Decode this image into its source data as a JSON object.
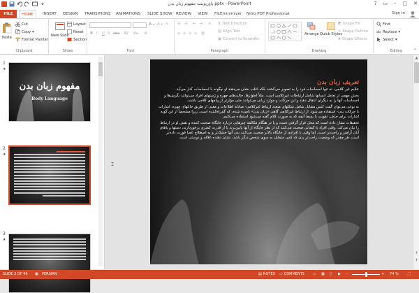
{
  "window": {
    "title": "پاورپوینت مفهوم زبان بدن.pptx - PowerPoint",
    "signin": "Sign in"
  },
  "tabs": [
    {
      "label": "FILE"
    },
    {
      "label": "HOME"
    },
    {
      "label": "INSERT"
    },
    {
      "label": "DESIGN"
    },
    {
      "label": "TRANSITIONS"
    },
    {
      "label": "ANIMATIONS"
    },
    {
      "label": "SLIDE SHOW"
    },
    {
      "label": "REVIEW"
    },
    {
      "label": "VIEW"
    },
    {
      "label": "FILEminimizer"
    },
    {
      "label": "Nitro PDF Professional"
    }
  ],
  "ribbon": {
    "clipboard": {
      "paste": "Paste",
      "cut": "Cut",
      "copy": "Copy",
      "format_painter": "Format Painter",
      "label": "Clipboard"
    },
    "slides": {
      "new_slide": "New Slide",
      "layout": "Layout",
      "reset": "Reset",
      "section": "Section",
      "label": "Slides"
    },
    "font": {
      "label": "Font"
    },
    "paragraph": {
      "text_direction": "Text Direction",
      "align_text": "Align Text",
      "convert_smartart": "Convert to SmartArt",
      "label": "Paragraph"
    },
    "drawing": {
      "arrange": "Arrange",
      "quick_styles": "Quick Styles",
      "shape_fill": "Shape Fill",
      "shape_outline": "Shape Outline",
      "shape_effects": "Shape Effects",
      "label": "Drawing"
    },
    "editing": {
      "find": "Find",
      "replace": "Replace",
      "select": "Select",
      "label": "Editing"
    }
  },
  "thumbnails": {
    "items": [
      {
        "number": "1",
        "title": "مفهوم زبان بدن",
        "subtitle": "Body Language"
      },
      {
        "number": "2"
      },
      {
        "number": "3"
      }
    ]
  },
  "slide": {
    "title": "تعریف زبان بدن",
    "paragraphs": [
      "علایم غیر کلامی، نه تنها احساسات فرد را به تصویر می‌کشند بلکه اغلب نشان می‌دهند او چگونه با احساسات کنار می‌آید.",
      "بخش مهمی از تعامل انسانها شامل ارتباطات غیرکلامی است. مثلاً اطوارها، حالت‌های چهره و ژستهای افراد می‌توانند نگرش‌ها و احساسات آنها را به دیگران انتقال دهند و این حرکات و موارد زبانی می‌توانند حتی مؤثرتر از پیامهای کلامی باشند.",
      "به نوعی می‌توان گفت کنش متقابل شامل شکلهای متعدد ارتباط غیرکلامی- مبادله اطلاعات و معنی از طریق حالتهای چهره، اشارات یا حرکات بدن- استفاده می‌شود. از ارتباط غیرکلامی گاهی «زبان بدن» نامیده شده، که گمراه‌کننده است، زیرا مشخصاً از این گونه اشارات برای حذف، تقویت یا بسط آنچه که به صورت کلام گفته می‌شود استفاده می‌کنیم.",
      "تحقیقات نشان داده است که محل قرار گرفتن دست و پا در هنگام مکالمه چیزهایی درباره جایگاه صحبت کننده و نقش او در ارتباط را بیان می‌کند. وقتی افراد با کسانی صحبت می‌کنند که از نظر جایگاه از آنها پایین‌ترند یا از قدرت کمتری برخوردارند، دستها و پاهای آنان آرامتر و راحت‌تر است. اما وقتی با افرادی از جایگاه بالاتر صحبت می‌کنند بدن آنها خشک‌تر و به اصطلاح عصا قورت داده‌تر است. هر چقدر که وضعیت راحت‌تر بدن که کمی متمایل به سوی شخص دیگر باشد، نشان دهنده علاقه و دوستی است."
    ]
  },
  "statusbar": {
    "slide_info": "SLIDE 2 OF 46",
    "language": "PERSIAN",
    "notes": "NOTES",
    "comments": "COMMENTS",
    "zoom": "74 %"
  },
  "colors": {
    "accent": "#d24726",
    "slide_title": "#e25a3a"
  }
}
